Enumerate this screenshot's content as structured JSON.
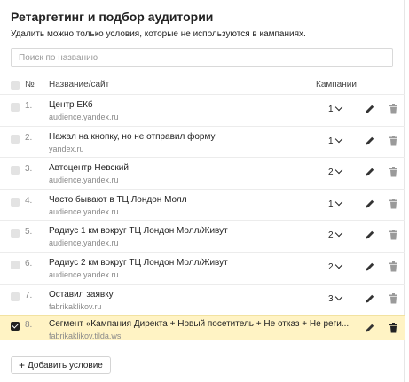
{
  "title": "Ретаргетинг и подбор аудитории",
  "subtitle": "Удалить можно только условия, которые не используются в кампаниях.",
  "search": {
    "placeholder": "Поиск по названию",
    "value": ""
  },
  "table": {
    "col_num": "№",
    "col_name": "Название/сайт",
    "col_campaigns": "Кампании"
  },
  "rows": [
    {
      "num": "1.",
      "name": "Центр ЕКб",
      "site": "audience.yandex.ru",
      "campaigns": "1",
      "checked": false
    },
    {
      "num": "2.",
      "name": "Нажал на кнопку, но не отправил форму",
      "site": "yandex.ru",
      "campaigns": "1",
      "checked": false
    },
    {
      "num": "3.",
      "name": "Автоцентр Невский",
      "site": "audience.yandex.ru",
      "campaigns": "2",
      "checked": false
    },
    {
      "num": "4.",
      "name": "Часто бывают в ТЦ Лондон Молл",
      "site": "audience.yandex.ru",
      "campaigns": "1",
      "checked": false
    },
    {
      "num": "5.",
      "name": "Радиус 1 км вокруг ТЦ Лондон Молл/Живут",
      "site": "audience.yandex.ru",
      "campaigns": "2",
      "checked": false
    },
    {
      "num": "6.",
      "name": "Радиус 2 км вокруг ТЦ Лондон Молл/Живут",
      "site": "audience.yandex.ru",
      "campaigns": "2",
      "checked": false
    },
    {
      "num": "7.",
      "name": "Оставил заявку",
      "site": "fabrikaklikov.ru",
      "campaigns": "3",
      "checked": false
    },
    {
      "num": "8.",
      "name": "Сегмент «Кампания Директа + Новый посетитель + Не отказ + Не реги...",
      "site": "fabrikaklikov.tilda.ws",
      "campaigns": "",
      "checked": true
    }
  ],
  "add_button": {
    "label": "Добавить условие"
  },
  "icons": {
    "edit": "pencil-icon",
    "delete": "trash-icon",
    "expand": "chevron-down-icon",
    "add": "plus-icon"
  },
  "colors": {
    "selected_row": "#fff3c4",
    "checkbox": "#e3e3e3",
    "text": "#222222",
    "muted": "#8a8a8a"
  }
}
